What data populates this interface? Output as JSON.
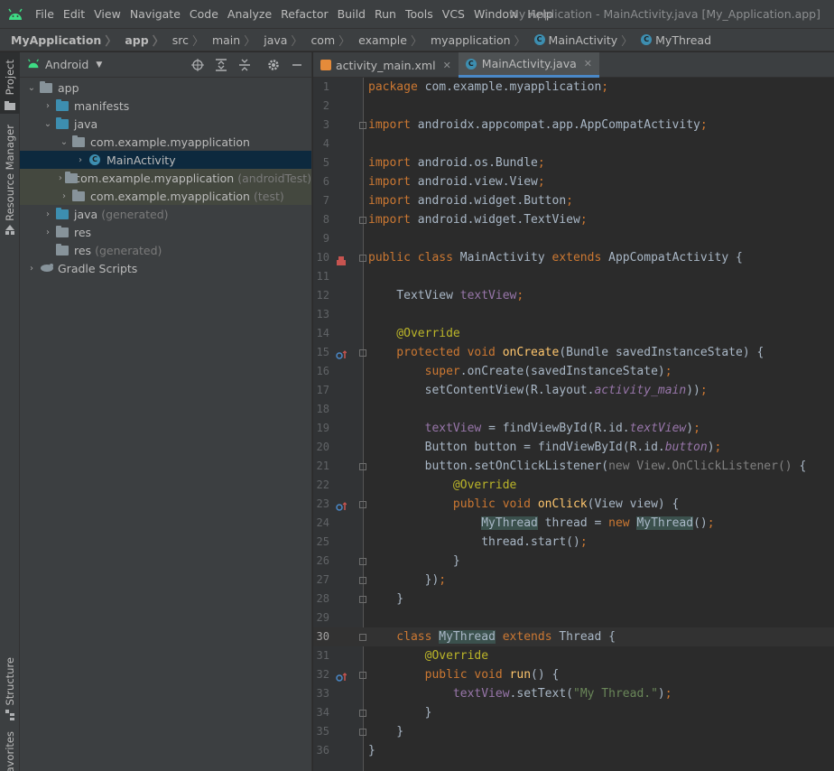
{
  "menubar": {
    "items": [
      "File",
      "Edit",
      "View",
      "Navigate",
      "Code",
      "Analyze",
      "Refactor",
      "Build",
      "Run",
      "Tools",
      "VCS",
      "Window",
      "Help"
    ],
    "window_title": "My Application - MainActivity.java [My_Application.app]"
  },
  "breadcrumb": [
    "MyApplication",
    "app",
    "src",
    "main",
    "java",
    "com",
    "example",
    "myapplication",
    "MainActivity",
    "MyThread"
  ],
  "left_strip": {
    "project": "Project",
    "resource_manager": "Resource Manager",
    "structure": "Structure",
    "favorites": "Favorites"
  },
  "project_panel": {
    "view_mode": "Android",
    "tree": [
      {
        "label": "app",
        "muted": ""
      },
      {
        "label": "manifests",
        "muted": ""
      },
      {
        "label": "java",
        "muted": ""
      },
      {
        "label": "com.example.myapplication",
        "muted": ""
      },
      {
        "label": "MainActivity",
        "muted": ""
      },
      {
        "label": "com.example.myapplication",
        "muted": "(androidTest)"
      },
      {
        "label": "com.example.myapplication",
        "muted": "(test)"
      },
      {
        "label": "java",
        "muted": "(generated)"
      },
      {
        "label": "res",
        "muted": ""
      },
      {
        "label": "res",
        "muted": "(generated)"
      },
      {
        "label": "Gradle Scripts",
        "muted": ""
      }
    ]
  },
  "editor": {
    "tabs": [
      {
        "label": "activity_main.xml",
        "active": false
      },
      {
        "label": "MainActivity.java",
        "active": true
      }
    ],
    "current_line": 30,
    "line_numbers": [
      "1",
      "2",
      "3",
      "4",
      "5",
      "6",
      "7",
      "8",
      "9",
      "10",
      "11",
      "12",
      "13",
      "14",
      "15",
      "16",
      "17",
      "18",
      "19",
      "20",
      "21",
      "22",
      "23",
      "24",
      "25",
      "26",
      "27",
      "28",
      "29",
      "30",
      "31",
      "32",
      "33",
      "34",
      "35",
      "36"
    ],
    "lines": [
      [
        [
          "kw",
          "package "
        ],
        [
          "",
          "com.example.myapplication"
        ],
        [
          "kw",
          ";"
        ]
      ],
      [],
      [
        [
          "kw",
          "import "
        ],
        [
          "",
          "androidx.appcompat.app.AppCompatActivity"
        ],
        [
          "kw",
          ";"
        ]
      ],
      [],
      [
        [
          "kw",
          "import "
        ],
        [
          "",
          "android.os.Bundle"
        ],
        [
          "kw",
          ";"
        ]
      ],
      [
        [
          "kw",
          "import "
        ],
        [
          "",
          "android.view.View"
        ],
        [
          "kw",
          ";"
        ]
      ],
      [
        [
          "kw",
          "import "
        ],
        [
          "",
          "android.widget.Button"
        ],
        [
          "kw",
          ";"
        ]
      ],
      [
        [
          "kw",
          "import "
        ],
        [
          "",
          "android.widget.TextView"
        ],
        [
          "kw",
          ";"
        ]
      ],
      [],
      [
        [
          "kw",
          "public class "
        ],
        [
          "",
          "MainActivity "
        ],
        [
          "kw",
          "extends "
        ],
        [
          "",
          "AppCompatActivity {"
        ]
      ],
      [],
      [
        [
          "",
          "    TextView "
        ],
        [
          "fld",
          "textView"
        ],
        [
          "kw",
          ";"
        ]
      ],
      [],
      [
        [
          "ann",
          "    @Override"
        ]
      ],
      [
        [
          "kw",
          "    protected void "
        ],
        [
          "fn",
          "onCreate"
        ],
        [
          "",
          "(Bundle savedInstanceState) {"
        ]
      ],
      [
        [
          "kw",
          "        super"
        ],
        [
          "",
          "."
        ],
        [
          "",
          "onCreate(savedInstanceState)"
        ],
        [
          "kw",
          ";"
        ]
      ],
      [
        [
          "",
          "        setContentView(R.layout."
        ],
        [
          "itl",
          "activity_main"
        ],
        [
          "",
          "))"
        ],
        [
          "kw",
          ";"
        ]
      ],
      [],
      [
        [
          "fld",
          "        textView "
        ],
        [
          "",
          "= findViewById(R.id."
        ],
        [
          "itl",
          "textView"
        ],
        [
          "",
          ")"
        ],
        [
          "kw",
          ";"
        ]
      ],
      [
        [
          "",
          "        Button button = findViewById(R.id."
        ],
        [
          "itl",
          "button"
        ],
        [
          "",
          ")"
        ],
        [
          "kw",
          ";"
        ]
      ],
      [
        [
          "",
          "        button.setOnClickListener("
        ],
        [
          "dim",
          "new View.OnClickListener() "
        ],
        [
          "",
          "{"
        ]
      ],
      [
        [
          "ann",
          "            @Override"
        ]
      ],
      [
        [
          "kw",
          "            public void "
        ],
        [
          "fn",
          "onClick"
        ],
        [
          "",
          "(View view) {"
        ]
      ],
      [
        [
          "",
          "                "
        ],
        [
          "hl",
          "MyThread"
        ],
        [
          "",
          " thread = "
        ],
        [
          "kw",
          "new "
        ],
        [
          "hl",
          "MyThread"
        ],
        [
          "",
          "()"
        ],
        [
          "kw",
          ";"
        ]
      ],
      [
        [
          "",
          "                thread.start()"
        ],
        [
          "kw",
          ";"
        ]
      ],
      [
        [
          "",
          "            }"
        ]
      ],
      [
        [
          "",
          "        })"
        ],
        [
          "kw",
          ";"
        ]
      ],
      [
        [
          "",
          "    }"
        ]
      ],
      [],
      [
        [
          "kw",
          "    class "
        ],
        [
          "hl",
          "MyThread"
        ],
        [
          "kw",
          " extends "
        ],
        [
          "",
          "Thread {"
        ]
      ],
      [
        [
          "ann",
          "        @Override"
        ]
      ],
      [
        [
          "kw",
          "        public void "
        ],
        [
          "fn",
          "run"
        ],
        [
          "",
          "() {"
        ]
      ],
      [
        [
          "fld",
          "            textView"
        ],
        [
          "",
          ".setText("
        ],
        [
          "str",
          "\"My Thread.\""
        ],
        [
          "",
          ")"
        ],
        [
          "kw",
          ";"
        ]
      ],
      [
        [
          "",
          "        }"
        ]
      ],
      [
        [
          "",
          "    }"
        ]
      ],
      [
        [
          "",
          "}"
        ]
      ]
    ]
  },
  "colors": {
    "background": "#2b2b2b",
    "panel": "#3c3f41",
    "keyword": "#cc7832",
    "annotation": "#bbb529",
    "field": "#9876aa",
    "method": "#ffc66d",
    "string": "#6a8759",
    "selection": "#0d293e"
  }
}
